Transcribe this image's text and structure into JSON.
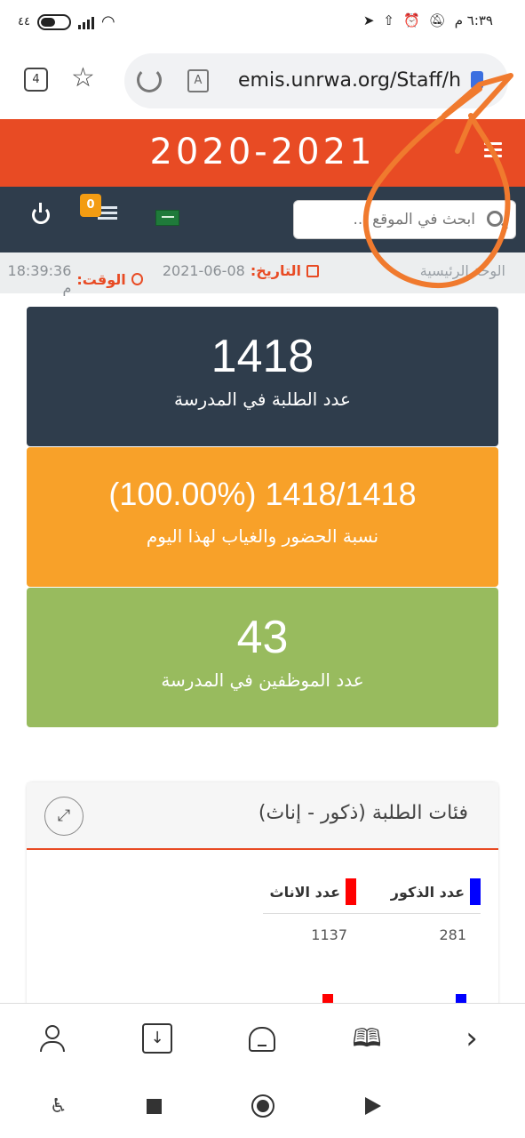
{
  "status_bar": {
    "time": "٦:٣٩ م",
    "battery": "٤٤"
  },
  "browser": {
    "tabs_count": "4",
    "url": "emis.unrwa.org/Staff/h",
    "reader_label": "A"
  },
  "site": {
    "year": "2020-2021",
    "notification_count": "0",
    "search_placeholder": "ابحث في الموقع ...",
    "breadcrumb": "الوحة الرئيسية",
    "date_label": "التاريخ:",
    "date_value": "2021-06-08",
    "time_label": "الوقت:",
    "time_value": "18:39:36 م"
  },
  "stats": [
    {
      "value": "1418",
      "label": "عدد الطلبة في المدرسة",
      "color": "#2f3d4c"
    },
    {
      "value": "(100.00%) 1418/1418",
      "label": "نسبة الحضور والغياب لهذا اليوم",
      "color": "#f8a129"
    },
    {
      "value": "43",
      "label": "عدد الموظفين في المدرسة",
      "color": "#98bb5e"
    }
  ],
  "panel": {
    "title": "فئات الطلبة (ذكور - إناث)",
    "male_label": "عدد الذكور",
    "female_label": "عدد الاناث",
    "male_value": "281",
    "female_value": "1137",
    "male_color": "#0000ff",
    "female_color": "#ff0000"
  },
  "icons": {
    "expand": "expand-icon",
    "search": "search-icon",
    "power": "power-icon"
  },
  "colors": {
    "header": "#e84b24",
    "navbar": "#2f3d4c",
    "annotation": "#f07a2e"
  }
}
